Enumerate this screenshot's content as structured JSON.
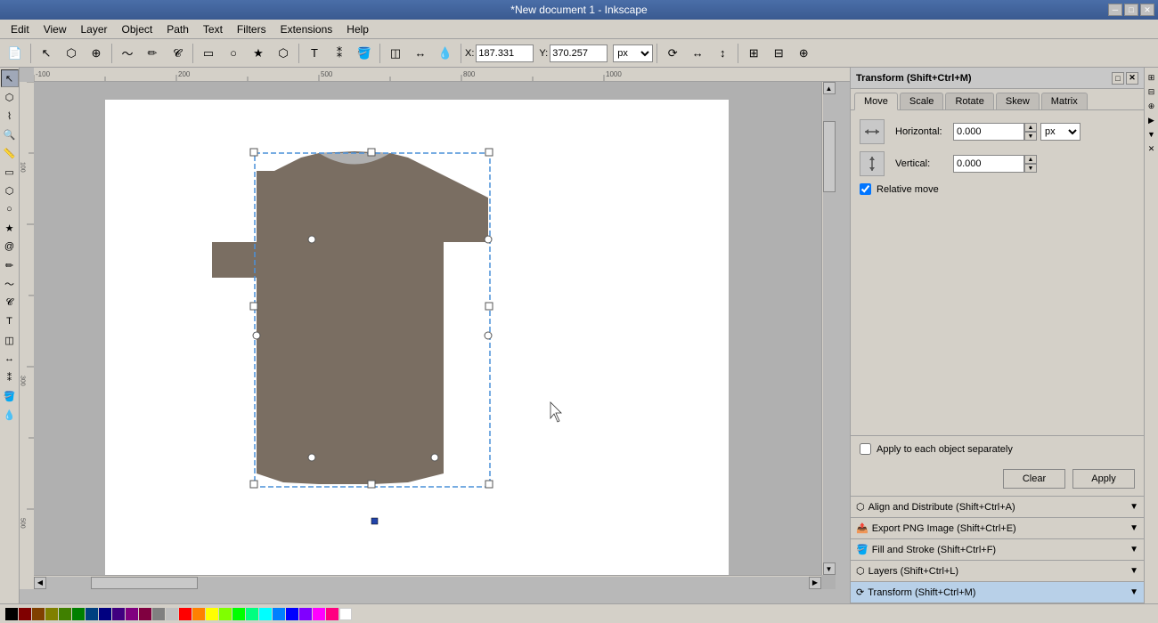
{
  "titlebar": {
    "title": "*New document 1 - Inkscape"
  },
  "menubar": {
    "items": [
      "Edit",
      "View",
      "Layer",
      "Object",
      "Path",
      "Text",
      "Filters",
      "Extensions",
      "Help"
    ]
  },
  "toolbar": {
    "x_label": "X:",
    "x_value": "187.331",
    "y_label": "Y:",
    "y_value": "370.257",
    "unit": "px"
  },
  "transform_panel": {
    "title": "Transform (Shift+Ctrl+M)",
    "tabs": [
      "Move",
      "Scale",
      "Rotate",
      "Skew",
      "Matrix"
    ],
    "active_tab": "Move",
    "horizontal_label": "Horizontal:",
    "horizontal_value": "0.000",
    "vertical_label": "Vertical:",
    "vertical_value": "0.000",
    "unit": "px",
    "relative_move_label": "Relative move",
    "relative_move_checked": true,
    "apply_each_label": "Apply to each object separately",
    "apply_each_checked": false,
    "clear_label": "Clear",
    "apply_label": "Apply"
  },
  "collapsed_panels": [
    {
      "id": "align",
      "label": "Align and Distribute (Shift+Ctrl+A)",
      "active": false
    },
    {
      "id": "export",
      "label": "Export PNG Image (Shift+Ctrl+E)",
      "active": false
    },
    {
      "id": "fill",
      "label": "Fill and Stroke (Shift+Ctrl+F)",
      "active": false
    },
    {
      "id": "layers",
      "label": "Layers (Shift+Ctrl+L)",
      "active": false
    },
    {
      "id": "transform",
      "label": "Transform (Shift+Ctrl+M)",
      "active": true
    }
  ],
  "tshirt": {
    "color": "#7a6e62"
  },
  "statusbar": {
    "colors": [
      "#000000",
      "#800000",
      "#808000",
      "#008000",
      "#800080",
      "#008080",
      "#000080",
      "#c0c0c0",
      "#808080",
      "#ff0000",
      "#ffff00",
      "#00ff00",
      "#ff00ff",
      "#00ffff",
      "#0000ff",
      "#ffffff",
      "#ff8000",
      "#80ff00",
      "#00ff80",
      "#0080ff",
      "#8000ff",
      "#ff0080",
      "#804000",
      "#408000",
      "#004080",
      "#400080",
      "#800040"
    ]
  }
}
